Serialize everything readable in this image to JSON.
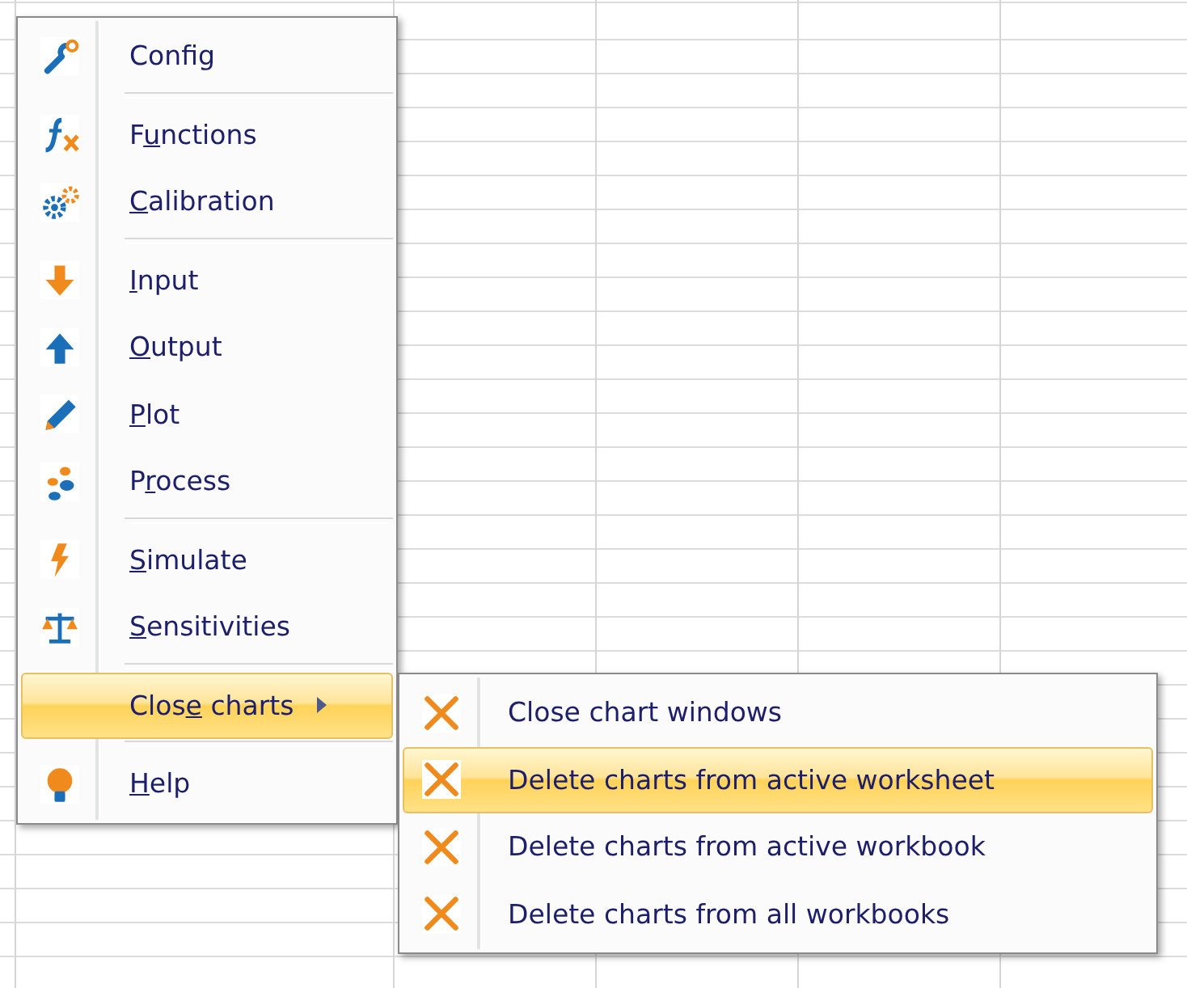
{
  "menu": {
    "items": [
      {
        "kind": "item",
        "label": [
          {
            "text": "Config",
            "underline": false
          }
        ],
        "selected": false
      },
      {
        "kind": "separator"
      },
      {
        "kind": "item",
        "label": [
          {
            "text": "F",
            "underline": false
          },
          {
            "text": "u",
            "underline": true
          },
          {
            "text": "nctions",
            "underline": false
          }
        ],
        "selected": false
      },
      {
        "kind": "item",
        "label": [
          {
            "text": "C",
            "underline": true
          },
          {
            "text": "alibration",
            "underline": false
          }
        ],
        "selected": false
      },
      {
        "kind": "separator"
      },
      {
        "kind": "item",
        "label": [
          {
            "text": "I",
            "underline": true
          },
          {
            "text": "nput",
            "underline": false
          }
        ],
        "selected": false
      },
      {
        "kind": "item",
        "label": [
          {
            "text": "O",
            "underline": true
          },
          {
            "text": "utput",
            "underline": false
          }
        ],
        "selected": false
      },
      {
        "kind": "item",
        "label": [
          {
            "text": "P",
            "underline": true
          },
          {
            "text": "lot",
            "underline": false
          }
        ],
        "selected": false
      },
      {
        "kind": "item",
        "label": [
          {
            "text": "P",
            "underline": false
          },
          {
            "text": "r",
            "underline": true
          },
          {
            "text": "ocess",
            "underline": false
          }
        ],
        "selected": false
      },
      {
        "kind": "separator"
      },
      {
        "kind": "item",
        "label": [
          {
            "text": "S",
            "underline": true
          },
          {
            "text": "imulate",
            "underline": false
          }
        ],
        "selected": false
      },
      {
        "kind": "item",
        "label": [
          {
            "text": "S",
            "underline": true
          },
          {
            "text": "ensitivities",
            "underline": false
          }
        ],
        "selected": false
      },
      {
        "kind": "separator"
      },
      {
        "kind": "submenu",
        "label": [
          {
            "text": "Clos",
            "underline": false
          },
          {
            "text": "e",
            "underline": true
          },
          {
            "text": " charts",
            "underline": false
          }
        ],
        "selected": true
      },
      {
        "kind": "separator"
      },
      {
        "kind": "item",
        "label": [
          {
            "text": "H",
            "underline": true
          },
          {
            "text": "elp",
            "underline": false
          }
        ],
        "selected": false
      }
    ]
  },
  "submenu": {
    "items": [
      {
        "label": "Close chart windows",
        "selected": false
      },
      {
        "label": "Delete charts from active worksheet",
        "selected": true
      },
      {
        "label": "Delete charts from active workbook",
        "selected": false
      },
      {
        "label": "Delete charts from all workbooks",
        "selected": false
      }
    ]
  }
}
